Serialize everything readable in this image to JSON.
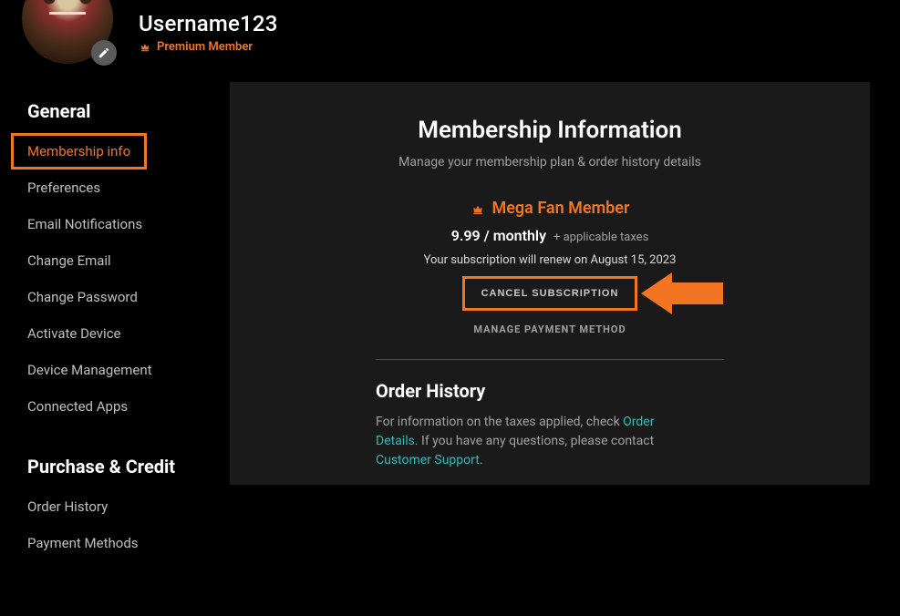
{
  "profile": {
    "username": "Username123",
    "premium_label": "Premium Member"
  },
  "sidebar": {
    "section1_title": "General",
    "section2_title": "Purchase & Credit",
    "items": [
      {
        "label": "Membership info",
        "name": "membership-info",
        "active": true
      },
      {
        "label": "Preferences",
        "name": "preferences"
      },
      {
        "label": "Email Notifications",
        "name": "email-notifications"
      },
      {
        "label": "Change Email",
        "name": "change-email"
      },
      {
        "label": "Change Password",
        "name": "change-password"
      },
      {
        "label": "Activate Device",
        "name": "activate-device"
      },
      {
        "label": "Device Management",
        "name": "device-management"
      },
      {
        "label": "Connected Apps",
        "name": "connected-apps"
      }
    ],
    "items2": [
      {
        "label": "Order History",
        "name": "order-history"
      },
      {
        "label": "Payment Methods",
        "name": "payment-methods"
      }
    ]
  },
  "panel": {
    "title": "Membership Information",
    "subtitle": "Manage your membership plan & order history details",
    "tier": "Mega Fan Member",
    "price": "9.99 / monthly",
    "tax_note": "+ applicable taxes",
    "renew_text": "Your subscription will renew on August 15, 2023",
    "cancel_label": "CANCEL SUBSCRIPTION",
    "manage_label": "MANAGE PAYMENT METHOD",
    "order_title": "Order History",
    "order_text_pre": "For information on the taxes applied, check ",
    "order_link1": "Order Details",
    "order_text_mid": ". If you have any questions, please contact ",
    "order_link2": "Customer Support",
    "order_text_post": "."
  },
  "colors": {
    "accent": "#f47521",
    "link": "#2abdbb"
  }
}
